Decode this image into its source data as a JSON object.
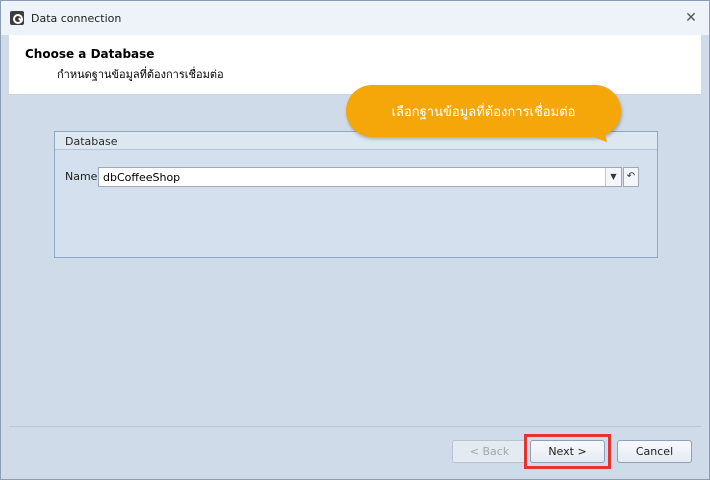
{
  "window": {
    "title": "Data connection",
    "close_symbol": "✕"
  },
  "header": {
    "title": "Choose a Database",
    "subtitle": "กำหนดฐานข้อมูลที่ต้องการเชื่อมต่อ"
  },
  "callout": {
    "text": "เลือกฐานข้อมูลที่ต้องการเชื่อมต่อ"
  },
  "database_group": {
    "title": "Database",
    "name_label": "Name",
    "name_value": "dbCoffeeShop",
    "dropdown_symbol": "▼",
    "undo_symbol": "↶"
  },
  "buttons": {
    "back": "< Back",
    "next": "Next >",
    "cancel": "Cancel"
  },
  "colors": {
    "callout": "#f5a608",
    "highlight": "#e3342f"
  },
  "icons": {
    "app": "wrench-settings-icon",
    "close": "close-icon",
    "dropdown": "chevron-down-icon",
    "undo": "undo-icon"
  }
}
